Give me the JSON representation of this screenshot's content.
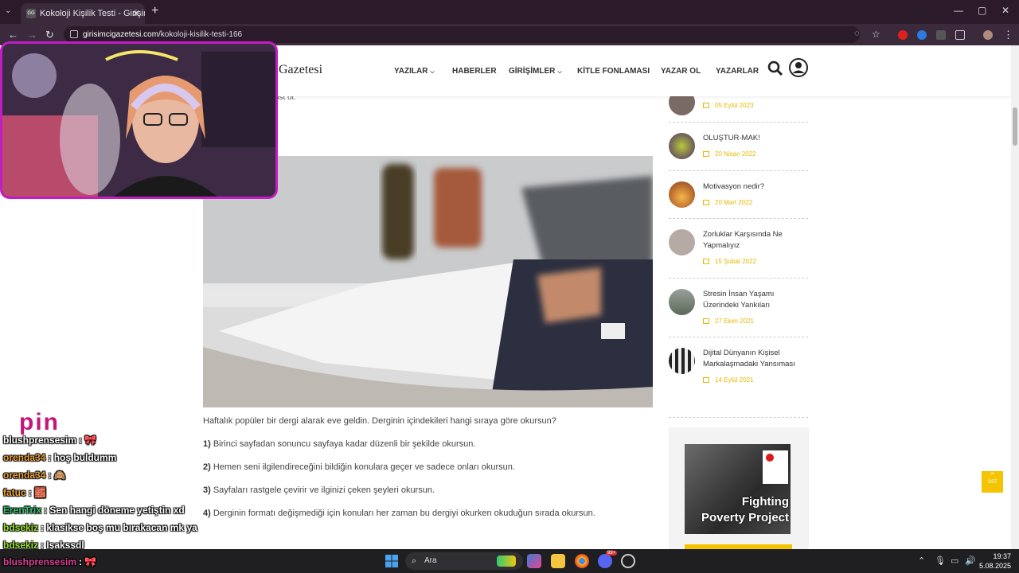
{
  "browser": {
    "tab_title": "Kokoloji Kişilik Testi - Girişimci G",
    "tab_close": "✕",
    "new_tab": "+",
    "url_host": "girisimcigazetesi.com",
    "url_path": "/kokoloji-kisilik-testi-166",
    "window_controls": [
      "—",
      "▢",
      "✕"
    ]
  },
  "site": {
    "logo_text": "Gazetesi",
    "nav": [
      {
        "label": "YAZILAR",
        "dropdown": true
      },
      {
        "label": "HABERLER",
        "dropdown": false
      },
      {
        "label": "GİRİŞİMLER",
        "dropdown": true
      },
      {
        "label": "KİTLE FONLAMASI",
        "dropdown": false
      },
      {
        "label": "YAZAR OL",
        "dropdown": false
      },
      {
        "label": "YAZARLAR",
        "dropdown": false
      }
    ],
    "fragment_text": "üst ol."
  },
  "article": {
    "question": "Haftalık popüler bir dergi alarak eve geldin. Derginin içindekileri hangi sıraya göre okursun?",
    "options": [
      {
        "num": "1)",
        "text": "Birinci sayfadan sonuncu sayfaya kadar düzenli bir şekilde okursun."
      },
      {
        "num": "2)",
        "text": "Hemen seni ilgilendireceğini bildiğin konulara geçer ve sadece onları okursun."
      },
      {
        "num": "3)",
        "text": "Sayfaları rastgele çevirir ve ilginizi çeken şeyleri okursun."
      },
      {
        "num": "4)",
        "text": "Derginin formatı değişmediği için konuları her zaman bu dergiyi okurken okuduğun sırada okursun."
      }
    ]
  },
  "sidebar": {
    "items": [
      {
        "title": "",
        "date": "05 Eylül 2023"
      },
      {
        "title": "OLUŞTUR-MAK!",
        "date": "20 Nisan 2022"
      },
      {
        "title": "Motivasyon nedir?",
        "date": "20 Mart 2022"
      },
      {
        "title": "Zorluklar Karşısında Ne Yapmalıyız",
        "date": "15 Şubat 2022"
      },
      {
        "title": "Stresin İnsan Yaşamı Üzerindeki Yankıları",
        "date": "27 Ekim 2021"
      },
      {
        "title": "Dijital Dünyanın Kişisel Markalaşmadaki Yansıması",
        "date": "14 Eylül 2021"
      }
    ],
    "ad_caption_1": "Fighting",
    "ad_caption_2": "Poverty Project"
  },
  "to_top": "ÜST",
  "chat": {
    "logo": "pin",
    "messages": [
      {
        "user": "blushprensesim",
        "text": ": 🎀",
        "color": "#ffffff"
      },
      {
        "user": "orenda34",
        "text": ": hoş buldumm",
        "color": "#e8a23a"
      },
      {
        "user": "orenda34",
        "text": ": 🙈",
        "color": "#e8a23a"
      },
      {
        "user": "fatuc",
        "text": ": 🧱",
        "color": "#e8a23a"
      },
      {
        "user": "ErenTrix",
        "text": ": Sen hangi döneme yetiştin xd",
        "color": "#2ecc71"
      },
      {
        "user": "bdsekiz",
        "text": ": klasikse boş mu bırakacan mk ya",
        "color": "#9be22d"
      },
      {
        "user": "bdsekiz",
        "text": ": Işaksşdl",
        "color": "#9be22d"
      },
      {
        "user": "blushprensesim",
        "text": ": 🎀",
        "color": "#e0409a"
      }
    ]
  },
  "taskbar": {
    "search_label": "Ara",
    "time": "19:37",
    "date": "5.08.2025",
    "badge": "99+"
  }
}
